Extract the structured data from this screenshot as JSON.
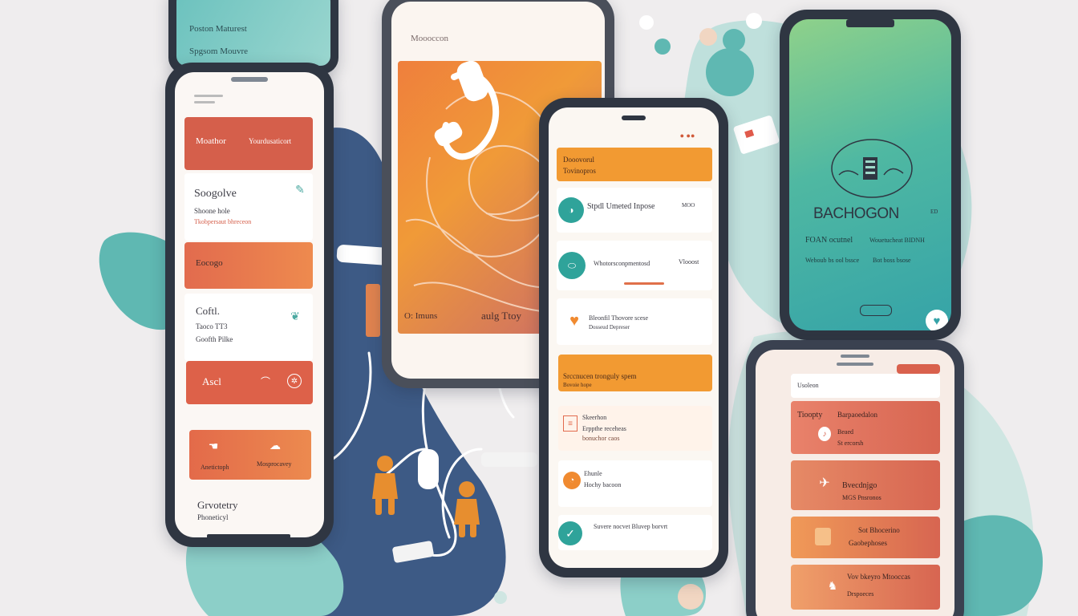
{
  "colors": {
    "background": "#efedee",
    "teal": "#5fb8b2",
    "navy": "#3d5a85",
    "coral": "#d9614d",
    "orange": "#f0932b",
    "frame": "#2f3642"
  },
  "phone_top_left": {
    "header": "Poston Maturest",
    "subheader": "Spgsom Mouvre"
  },
  "phone_left": {
    "top_card": {
      "left": "Moathor",
      "right": "Yourdusaticort"
    },
    "card2": {
      "title": "Soogolve",
      "line1": "Shoone hole",
      "line2": "Tkobpersaut bhreceon"
    },
    "card3": {
      "label": "Eocogo"
    },
    "card4": {
      "title": "Coftl.",
      "line1": "Taoco TT3",
      "line2": "Goofth Pilke"
    },
    "card5": {
      "label": "Ascl"
    },
    "card6": {
      "label1": "Anetictoph",
      "label2": "Mosprocavey"
    },
    "bottom": {
      "title": "Grvotetry",
      "sub": "Phoneticyl"
    }
  },
  "phone_center": {
    "header": "Moooccon",
    "bottom_left": "O: Imuns",
    "bottom_right": "aulg Ttoy"
  },
  "phone_middle": {
    "header": {
      "line1": "Dooovorul",
      "line2": "Tovinopros"
    },
    "row1": {
      "title": "Stpdl Umeted Inpose",
      "badge": "MOO"
    },
    "row2": {
      "title": "Whotorsconpmentosd",
      "badge": "Vlooost"
    },
    "row3": {
      "title": "Bleonfil Thovore scese",
      "sub": "Dosseud Depreser"
    },
    "orange_block": {
      "line1": "Srccnucen tronguly spem",
      "line2": "Bovoie hope"
    },
    "row5": {
      "title": "Skeerhon",
      "line1": "Erppthe receheas",
      "line2": "bonuchor caos"
    },
    "row6": {
      "title": "Ehunle",
      "sub": "Hochy bacoon"
    },
    "row7": {
      "title": "Suvere nocvet Bluvep borvrt"
    }
  },
  "phone_right_top": {
    "logo": "BACHOGON",
    "logo_sup": "ED",
    "line1": "FOAN ocutnel",
    "line1b": "Wouetucheat BIDNH",
    "line2": "Weboub bs ool bssce",
    "line2b": "Bot boss bsose"
  },
  "phone_right_bottom": {
    "header": "Usoleon",
    "row1": {
      "title": "Tioopty",
      "sub": "Barpaoedalon",
      "sub2": "Beaed",
      "sub3": "St ercorsh"
    },
    "row2": {
      "title": "Bvecdnjgo",
      "sub": "MGS Pnsronos"
    },
    "row3": {
      "title": "Sot Bhocerino",
      "sub": "Gaobephoses"
    },
    "row4": {
      "title": "Vov bkeyro Mtooccas",
      "sub": "Drspoeces"
    }
  }
}
